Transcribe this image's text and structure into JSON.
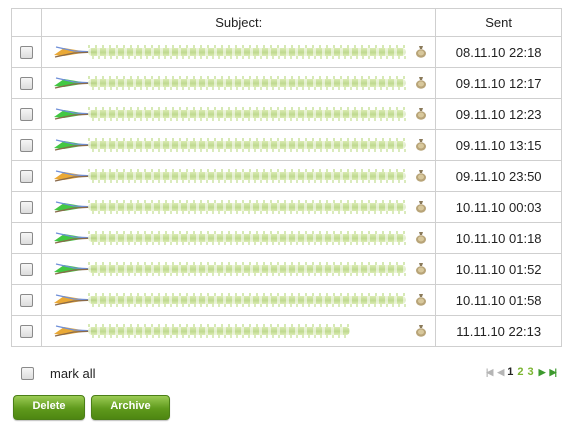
{
  "table": {
    "headers": {
      "subject": "Subject:",
      "sent": "Sent"
    },
    "rows": [
      {
        "sent": "08.11.10 22:18",
        "feather": "orange"
      },
      {
        "sent": "09.11.10 12:17",
        "feather": "green"
      },
      {
        "sent": "09.11.10 12:23",
        "feather": "green"
      },
      {
        "sent": "09.11.10 13:15",
        "feather": "green"
      },
      {
        "sent": "09.11.10 23:50",
        "feather": "orange"
      },
      {
        "sent": "10.11.10 00:03",
        "feather": "green"
      },
      {
        "sent": "10.11.10 01:18",
        "feather": "green"
      },
      {
        "sent": "10.11.10 01:52",
        "feather": "green"
      },
      {
        "sent": "10.11.10 01:58",
        "feather": "orange"
      },
      {
        "sent": "11.11.10 22:13",
        "feather": "orange"
      }
    ]
  },
  "footer": {
    "mark_all_label": "mark all"
  },
  "pagination": {
    "current": "1",
    "pages": [
      "1",
      "2",
      "3"
    ]
  },
  "buttons": {
    "delete": "Delete",
    "archive": "Archive"
  },
  "colors": {
    "accent_green": "#6aa52a",
    "subject_scribble": "#c8e09a",
    "orange_feather": "#e8a020",
    "green_feather": "#2ec22e"
  }
}
